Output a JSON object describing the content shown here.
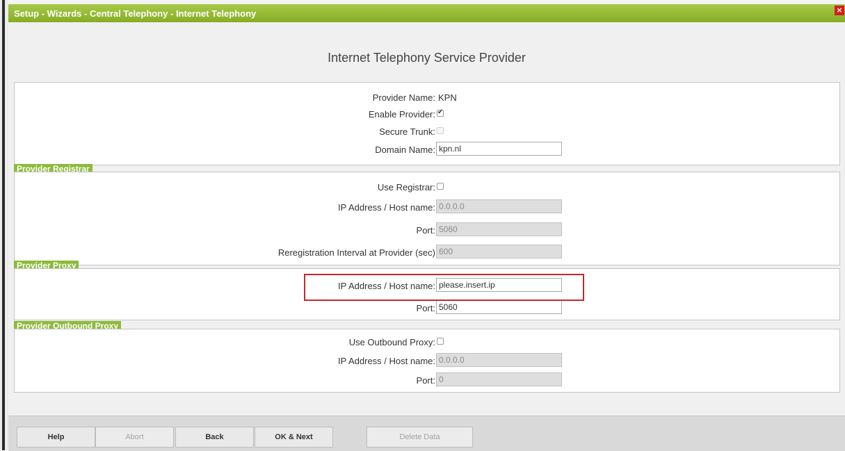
{
  "window": {
    "title": "Setup - Wizards - Central Telephony - Internet Telephony",
    "close_glyph": "×",
    "accent_color": "#8dba3a",
    "highlight_color": "#c8262a"
  },
  "page": {
    "heading": "Internet Telephony Service Provider"
  },
  "provider": {
    "name_label": "Provider Name:",
    "name_value": "KPN",
    "enable_label": "Enable Provider:",
    "enable_checked": true,
    "secure_label": "Secure Trunk:",
    "secure_checked": false,
    "domain_label": "Domain Name:",
    "domain_value": "kpn.nl"
  },
  "registrar": {
    "section_title": "Provider Registrar",
    "use_label": "Use Registrar:",
    "use_checked": false,
    "ip_label": "IP Address / Host name:",
    "ip_value": "0.0.0.0",
    "port_label": "Port:",
    "port_value": "5060",
    "interval_label": "Reregistration Interval at Provider (sec)",
    "interval_value": "600"
  },
  "proxy": {
    "section_title": "Provider Proxy",
    "ip_label": "IP Address / Host name:",
    "ip_value": "please.insert.ip",
    "port_label": "Port:",
    "port_value": "5060"
  },
  "outbound": {
    "section_title": "Provider Outbound Proxy",
    "use_label": "Use Outbound Proxy:",
    "use_checked": false,
    "ip_label": "IP Address / Host name:",
    "ip_value": "0.0.0.0",
    "port_label": "Port:",
    "port_value": "0"
  },
  "footer": {
    "help": "Help",
    "abort": "Abort",
    "back": "Back",
    "ok_next": "OK & Next",
    "delete": "Delete Data"
  }
}
